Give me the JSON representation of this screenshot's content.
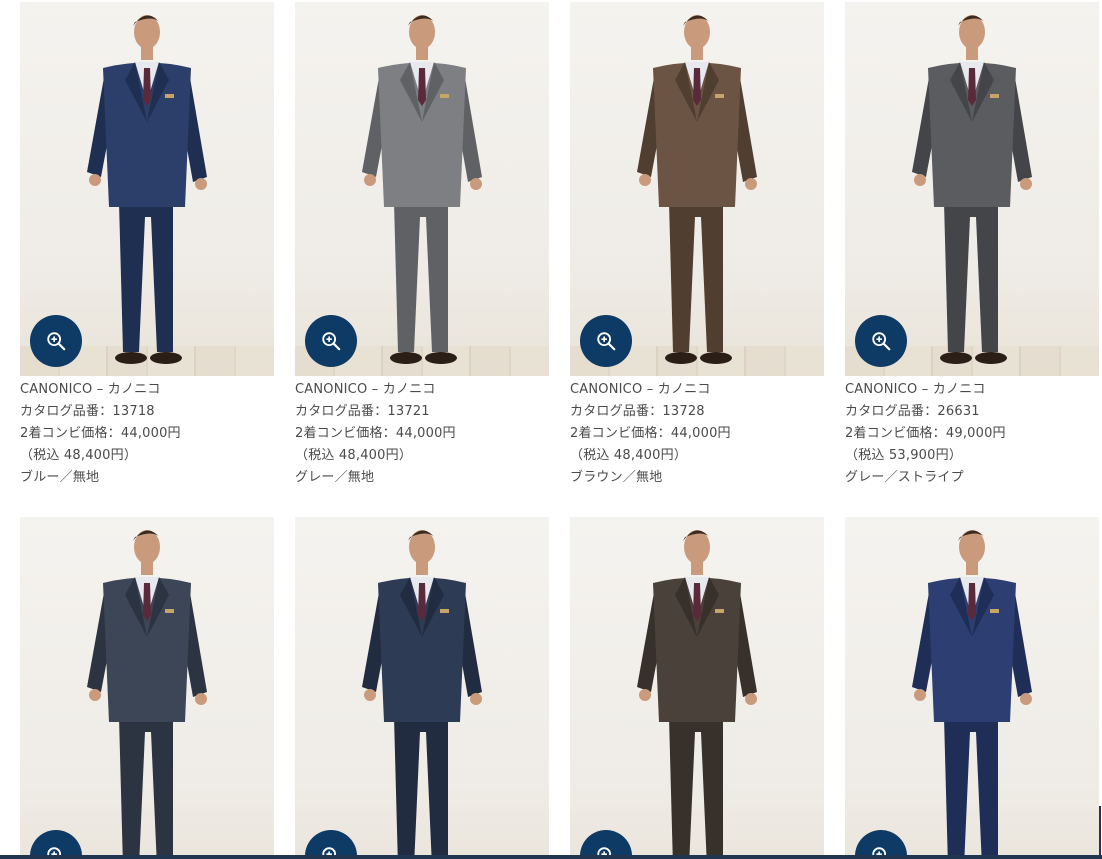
{
  "products": [
    {
      "brand": "CANONICO – カノニコ",
      "catalog": "カタログ品番：13718",
      "price": "2着コンビ価格：44,000円",
      "tax": "（税込 48,400円）",
      "color": "ブルー／無地",
      "suit_color": "#2b3f6a",
      "suit_shade": "#1e2f52",
      "style": "3piece"
    },
    {
      "brand": "CANONICO – カノニコ",
      "catalog": "カタログ品番：13721",
      "price": "2着コンビ価格：44,000円",
      "tax": "（税込 48,400円）",
      "color": "グレー／無地",
      "suit_color": "#7d7f82",
      "suit_shade": "#5f6164",
      "style": "double"
    },
    {
      "brand": "CANONICO – カノニコ",
      "catalog": "カタログ品番：13728",
      "price": "2着コンビ価格：44,000円",
      "tax": "（税込 48,400円）",
      "color": "ブラウン／無地",
      "suit_color": "#6b5444",
      "suit_shade": "#503e31",
      "style": "3piece"
    },
    {
      "brand": "CANONICO – カノニコ",
      "catalog": "カタログ品番：26631",
      "price": "2着コンビ価格：49,000円",
      "tax": "（税込 53,900円）",
      "color": "グレー／ストライプ",
      "suit_color": "#5a5c5f",
      "suit_shade": "#434548",
      "style": "3piece"
    },
    {
      "brand": "",
      "catalog": "",
      "price": "",
      "tax": "",
      "color": "",
      "suit_color": "#3d4656",
      "suit_shade": "#2c3442",
      "style": "3piece"
    },
    {
      "brand": "",
      "catalog": "",
      "price": "",
      "tax": "",
      "color": "",
      "suit_color": "#2e3b55",
      "suit_shade": "#222c41",
      "style": "double"
    },
    {
      "brand": "",
      "catalog": "",
      "price": "",
      "tax": "",
      "color": "",
      "suit_color": "#4a413b",
      "suit_shade": "#37302b",
      "style": "double"
    },
    {
      "brand": "",
      "catalog": "",
      "price": "",
      "tax": "",
      "color": "",
      "suit_color": "#2d3f72",
      "suit_shade": "#1f2e57",
      "style": "3piece"
    }
  ],
  "icons": {
    "zoom": "zoom-in-icon"
  },
  "colors": {
    "zoom_button": "#0e3a66",
    "text": "#4a4a4a"
  }
}
